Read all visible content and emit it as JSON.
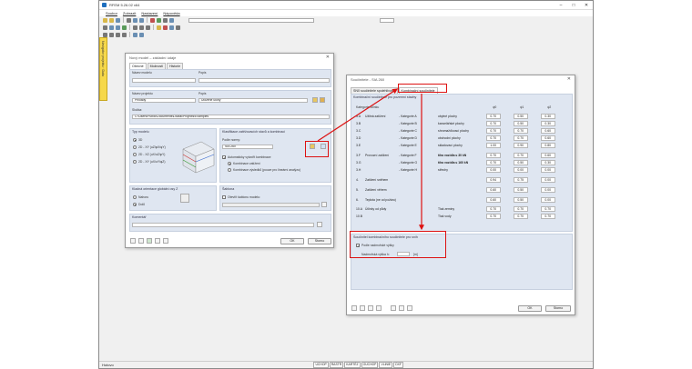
{
  "app": {
    "title": "RFEM 5.26.02 x64",
    "menu": [
      "Soubor",
      "Zobrazit",
      "Nastavení",
      "Nápověda"
    ],
    "side_tab": "Navigátor projektu · Data",
    "status": "Hotovo",
    "modes": [
      "UCHOP",
      "RASTR",
      "KARTÉZ",
      "OUCHOP",
      "VLINIE",
      "DXF"
    ]
  },
  "model_dialog": {
    "title": "Nový model – základní údaje",
    "tabs": [
      "Obecné",
      "Možnosti",
      "Historie"
    ],
    "model_name_label": "Název modelu",
    "description_label": "Popis",
    "model_name_value": "",
    "description_value": "",
    "project_name_label": "Název projektu",
    "project_description_label": "Popis",
    "project_value": "Příklady",
    "project_description_value": "Uložené úlohy",
    "folder_label": "Složka:",
    "folder_value": "C:\\Users\\Public\\Documents\\Dlubal\\Projects\\Examples",
    "model_type_label": "Typ modelu",
    "model_types": [
      "3D",
      "2D - XY (uZ/φX/φY)",
      "2D - XZ (uX/uZ/φY)",
      "2D - XY (uX/uY/φZ)"
    ],
    "classification_label": "Klasifikace zatěžovacích stavů a kombinací",
    "standard_label": "Podle normy:",
    "standard_value": "SIA 260",
    "auto_combos_label": "Automaticky vytvořit kombinace",
    "combo_options": [
      "Kombinace zatížení",
      "Kombinace výsledků (pouze pro lineární analýzu)"
    ],
    "gravity_label": "Kladná orientace globální osy Z",
    "gravity_options": [
      "Nahoru",
      "Dolů"
    ],
    "template_label": "Šablona",
    "template_option": "Otevřít šablonu modelu:",
    "comment_label": "Komentář",
    "ok": "OK",
    "cancel": "Storno"
  },
  "coef_dialog": {
    "title": "Součinitele - SIA 260",
    "tabs": [
      "SN0 součinitele spolehlivosti",
      "Kombinační součinitele"
    ],
    "section_title": "Kombinační součinitele pro pozemní stavby",
    "category_header": "Kategorie účinku",
    "columns": [
      "ψ0",
      "ψ1",
      "ψ2"
    ],
    "rows": [
      {
        "code": "3.A",
        "name": "Užitná zatížení",
        "cat": "Kategorie A",
        "desc": "obytné plochy",
        "v": [
          "0.70",
          "0.50",
          "0.30"
        ]
      },
      {
        "code": "3.B",
        "name": "",
        "cat": "Kategorie B",
        "desc": "kancelářské plochy",
        "v": [
          "0.70",
          "0.50",
          "0.30"
        ]
      },
      {
        "code": "3.C",
        "name": "",
        "cat": "Kategorie C",
        "desc": "shromažďovací plochy",
        "v": [
          "0.70",
          "0.70",
          "0.60"
        ]
      },
      {
        "code": "3.D",
        "name": "",
        "cat": "Kategorie D",
        "desc": "obchodní plochy",
        "v": [
          "0.70",
          "0.70",
          "0.60"
        ]
      },
      {
        "code": "3.E",
        "name": "",
        "cat": "Kategorie E",
        "desc": "skladovací plochy",
        "v": [
          "1.00",
          "0.90",
          "0.80"
        ]
      },
      {
        "code": "3.F",
        "name": "Provozní zatížení",
        "cat": "Kategorie F",
        "desc": "tíha vozidla ≤ 30 kN",
        "v": [
          "0.70",
          "0.70",
          "0.60"
        ]
      },
      {
        "code": "3.G",
        "name": "",
        "cat": "Kategorie G",
        "desc": "tíha vozidla ≤ 160 kN",
        "v": [
          "0.70",
          "0.50",
          "0.30"
        ]
      },
      {
        "code": "3.H",
        "name": "",
        "cat": "Kategorie H",
        "desc": "střechy",
        "v": [
          "0.00",
          "0.00",
          "0.00"
        ]
      },
      {
        "code": "4.",
        "name": "Zatížení sněhem",
        "cat": "",
        "desc": "",
        "v": [
          "0.94",
          "0.75",
          "0.00"
        ]
      },
      {
        "code": "5.",
        "name": "Zatížení větrem",
        "cat": "",
        "desc": "",
        "v": [
          "0.60",
          "0.50",
          "0.00"
        ]
      },
      {
        "code": "6.",
        "name": "Teplota (ne od požáru)",
        "cat": "",
        "desc": "",
        "v": [
          "0.60",
          "0.50",
          "0.00"
        ]
      },
      {
        "code": "10.A",
        "name": "Účinky od půdy",
        "cat": "",
        "desc": "Tlak zeminy",
        "v": [
          "0.70",
          "0.70",
          "0.70"
        ]
      },
      {
        "code": "10.B",
        "name": "",
        "cat": "",
        "desc": "Tlak vody",
        "v": [
          "0.70",
          "0.70",
          "0.70"
        ]
      }
    ],
    "snow_section_title": "Součinitel kombinačního součinitele pro sníh",
    "snow_check_label": "Podle nadmořské výšky",
    "altitude_label": "Nadmořská výška h:",
    "altitude_unit": "[m]",
    "altitude_value": "",
    "ok": "OK",
    "cancel": "Storno"
  },
  "colors": {
    "highlight": "#dd1111",
    "section": "#dfe6f1",
    "side_tab": "#f6d84a"
  }
}
